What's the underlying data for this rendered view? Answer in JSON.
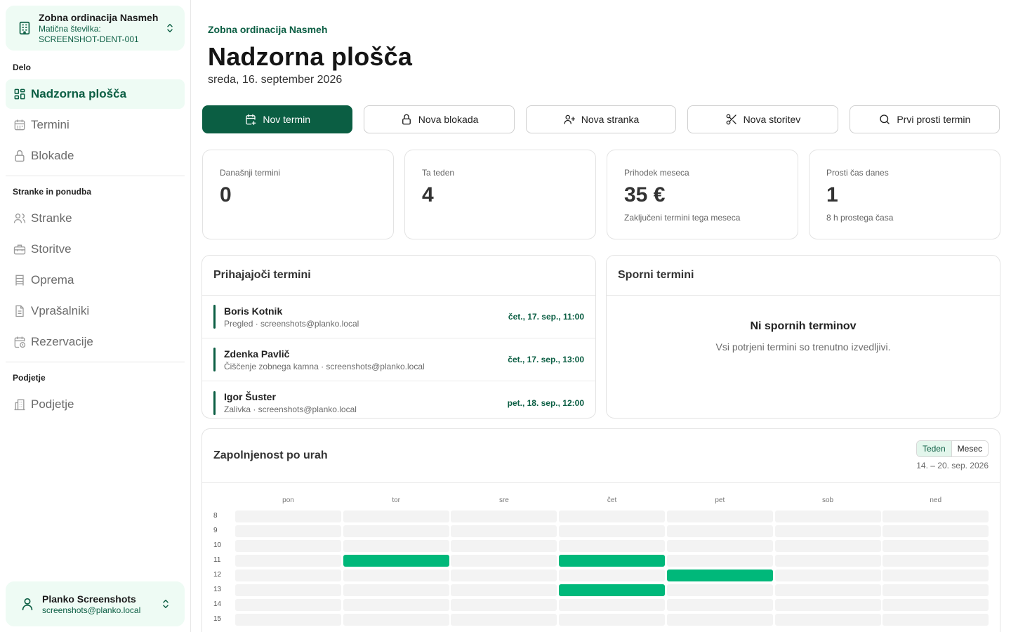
{
  "sidebar": {
    "org": {
      "name": "Zobna ordinacija Nasmeh",
      "sub": "Matična številka: SCREENSHOT-DENT-001"
    },
    "sections": {
      "work": "Delo",
      "clients": "Stranke in ponudba",
      "company": "Podjetje"
    },
    "items": {
      "dashboard": "Nadzorna plošča",
      "appointments": "Termini",
      "blocks": "Blokade",
      "clients": "Stranke",
      "services": "Storitve",
      "equipment": "Oprema",
      "questionnaires": "Vprašalniki",
      "reservations": "Rezervacije",
      "company": "Podjetje"
    },
    "user": {
      "name": "Planko Screenshots",
      "email": "screenshots@planko.local"
    }
  },
  "header": {
    "breadcrumb": "Zobna ordinacija Nasmeh",
    "title": "Nadzorna plošča",
    "date": "sreda, 16. september 2026"
  },
  "actions": {
    "new_appointment": "Nov termin",
    "new_block": "Nova blokada",
    "new_client": "Nova stranka",
    "new_service": "Nova storitev",
    "first_free": "Prvi prosti termin"
  },
  "stats": [
    {
      "label": "Današnji termini",
      "value": "0",
      "sub": ""
    },
    {
      "label": "Ta teden",
      "value": "4",
      "sub": ""
    },
    {
      "label": "Prihodek meseca",
      "value": "35 €",
      "sub": "Zaključeni termini tega meseca"
    },
    {
      "label": "Prosti čas danes",
      "value": "1",
      "sub": "8 h prostega časa"
    }
  ],
  "upcoming": {
    "title": "Prihajajoči termini",
    "items": [
      {
        "name": "Boris Kotnik",
        "sub": "Pregled · screenshots@planko.local",
        "time": "čet., 17. sep., 11:00"
      },
      {
        "name": "Zdenka Pavlič",
        "sub": "Čiščenje zobnega kamna · screenshots@planko.local",
        "time": "čet., 17. sep., 13:00"
      },
      {
        "name": "Igor Šuster",
        "sub": "Zalivka · screenshots@planko.local",
        "time": "pet., 18. sep., 12:00"
      }
    ]
  },
  "disputed": {
    "title": "Sporni termini",
    "empty_title": "Ni spornih terminov",
    "empty_sub": "Vsi potrjeni termini so trenutno izvedljivi."
  },
  "occupancy": {
    "title": "Zapolnjenost po urah",
    "toggle_week": "Teden",
    "toggle_month": "Mesec",
    "range": "14. – 20. sep. 2026",
    "days": [
      "pon",
      "tor",
      "sre",
      "čet",
      "pet",
      "sob",
      "ned"
    ],
    "hours": [
      "8",
      "9",
      "10",
      "11",
      "12",
      "13",
      "14",
      "15"
    ],
    "busy": [
      {
        "day": 1,
        "hour": 3
      },
      {
        "day": 3,
        "hour": 3
      },
      {
        "day": 4,
        "hour": 4
      },
      {
        "day": 3,
        "hour": 5
      }
    ]
  },
  "colors": {
    "accent": "#0b5e43",
    "busy": "#00b87a",
    "accent_bg": "#eefbf4"
  }
}
